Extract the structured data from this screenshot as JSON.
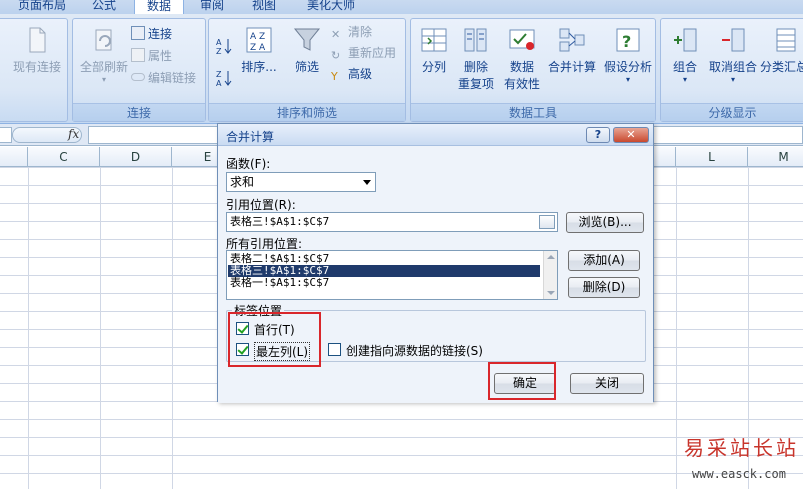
{
  "ribbon": {
    "tabs": [
      {
        "label": "页面布局",
        "active": false
      },
      {
        "label": "公式",
        "active": false
      },
      {
        "label": "数据",
        "active": true
      },
      {
        "label": "审阅",
        "active": false
      },
      {
        "label": "视图",
        "active": false
      },
      {
        "label": "美化大师",
        "active": false
      }
    ],
    "groups": {
      "external": {
        "existing_connections": "现有连接"
      },
      "connections": {
        "label": "连接",
        "refresh_all": "全部刷新",
        "connections": "连接",
        "properties": "属性",
        "edit_links": "编辑链接"
      },
      "sort_filter": {
        "label": "排序和筛选",
        "sort": "排序...",
        "filter": "筛选",
        "clear": "清除",
        "reapply": "重新应用",
        "advanced": "高级"
      },
      "data_tools": {
        "label": "数据工具",
        "text_to_columns": "分列",
        "remove_duplicates_1": "删除",
        "remove_duplicates_2": "重复项",
        "data_validation_1": "数据",
        "data_validation_2": "有效性",
        "consolidate": "合并计算",
        "what_if": "假设分析"
      },
      "outline": {
        "label": "分级显示",
        "group": "组合",
        "ungroup": "取消组合",
        "subtotal": "分类汇总"
      }
    }
  },
  "formula_bar": {
    "fx": "fx"
  },
  "sheet": {
    "columns": [
      "C",
      "D",
      "E",
      "L",
      "M"
    ]
  },
  "dialog": {
    "title": "合并计算",
    "help": "?",
    "close": "✕",
    "function_label": "函数(F):",
    "function_value": "求和",
    "reference_label": "引用位置(R):",
    "reference_value": "表格三!$A$1:$C$7",
    "browse": "浏览(B)...",
    "all_references_label": "所有引用位置:",
    "references": [
      {
        "text": "表格二!$A$1:$C$7",
        "selected": false
      },
      {
        "text": "表格三!$A$1:$C$7",
        "selected": true
      },
      {
        "text": "表格一!$A$1:$C$7",
        "selected": false
      }
    ],
    "add": "添加(A)",
    "delete": "删除(D)",
    "use_labels_label": "标签位置",
    "top_row": {
      "label": "首行(T)",
      "checked": true
    },
    "left_column": {
      "label": "最左列(L)",
      "checked": true
    },
    "create_links": {
      "label": "创建指向源数据的链接(S)",
      "checked": false
    },
    "ok": "确定",
    "close_button": "关闭"
  },
  "watermark": {
    "title": "易采站长站",
    "url": "www.easck.com"
  }
}
